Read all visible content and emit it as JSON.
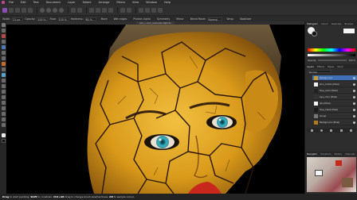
{
  "menubar": {
    "items": [
      "File",
      "Edit",
      "Text",
      "Document",
      "Layer",
      "Select",
      "Arrange",
      "Filters",
      "View",
      "Window",
      "Help"
    ]
  },
  "context": {
    "width_label": "Width:",
    "width_value": "21 px",
    "opacity_label": "Opacity:",
    "opacity_value": "100 %",
    "flow_label": "Flow:",
    "flow_value": "100 %",
    "hardness_label": "Hardness:",
    "hardness_value": "80 %",
    "more_label": "More",
    "wet_edges_label": "Wet edges",
    "protect_alpha_label": "Protect Alpha",
    "blend_mode_value": "Normal",
    "symmetry_label": "Symmetry",
    "mirror_label": "Mirror",
    "blend_label": "Blend Mode:",
    "blend_value": "Normal",
    "wrap_label": "Wrap",
    "stabilizer_label": "Stabilizer"
  },
  "document": {
    "tab_title": "skin_crack_example.afphoto"
  },
  "panel": {
    "top_tabs": [
      "Histogram",
      "Colour",
      "Swatches",
      "Brushes"
    ],
    "opacity_label": "Opacity:",
    "opacity_value": "100 %",
    "layers_tabs": [
      "Layers",
      "Effects",
      "Styles",
      "Stock"
    ],
    "blend_value": "Normal",
    "layers": [
      {
        "name": "Background",
        "selected": true
      },
      {
        "name": "skin_cracks (Pixel)",
        "selected": false
      },
      {
        "name": "face_color (Pixel)",
        "selected": false
      },
      {
        "name": "eye_color (Pixel)",
        "selected": false
      },
      {
        "name": "lips (Pixel)",
        "selected": false
      },
      {
        "name": "face_mask (Pixel)",
        "selected": false
      },
      {
        "name": "Group",
        "selected": false
      },
      {
        "name": "Background (Pixel)",
        "selected": false
      }
    ],
    "bottom_tabs": [
      "Navigator",
      "Transform",
      "History",
      "Channels"
    ],
    "navigator_label": "Navigator"
  },
  "statusbar": {
    "parts": [
      {
        "bold": "Drag",
        "text": " to start painting. "
      },
      {
        "bold": "Shift",
        "text": " to constrain. "
      },
      {
        "bold": "Ctrl+Alt",
        "text": " drag to change brush size/hardness. "
      },
      {
        "bold": "Alt",
        "text": " to sample colour."
      }
    ]
  },
  "colors": {
    "accent": "#8a4fb0",
    "selection": "#3f6fb4",
    "skin": "#e6ac1c",
    "eye": "#2fb7c6",
    "lips": "#c8281c"
  }
}
